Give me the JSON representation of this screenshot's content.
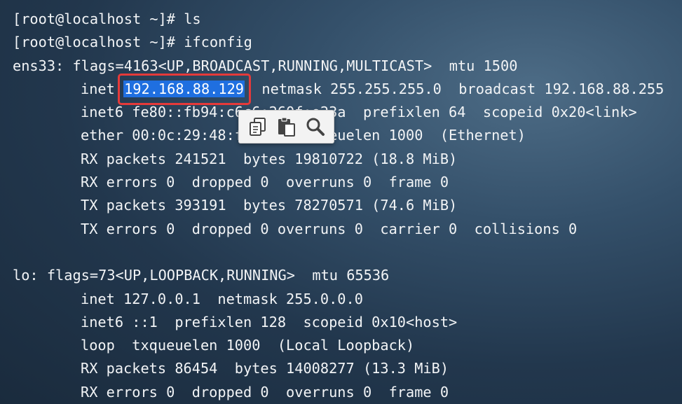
{
  "terminal": {
    "prompt_ls": "[root@localhost ~]# ls",
    "prompt_ifconfig": "[root@localhost ~]# ifconfig",
    "ens33": {
      "header": "ens33: flags=4163<UP,BROADCAST,RUNNING,MULTICAST>  mtu 1500",
      "inet_label": "inet ",
      "inet_ip": "192.168.88.129",
      "inet_rest": "  netmask 255.255.255.0  broadcast 192.168.88.255",
      "inet6": "inet6 fe80::fb94:c6c6:260f:e23a  prefixlen 64  scopeid 0x20<link>",
      "ether": "ether 00:0c:29:48:f4:bd  txqueuelen 1000  (Ethernet)",
      "rx_packets": "RX packets 241521  bytes 19810722 (18.8 MiB)",
      "rx_errors": "RX errors 0  dropped 0  overruns 0  frame 0",
      "tx_packets": "TX packets 393191  bytes 78270571 (74.6 MiB)",
      "tx_errors": "TX errors 0  dropped 0 overruns 0  carrier 0  collisions 0"
    },
    "lo": {
      "header": "lo: flags=73<UP,LOOPBACK,RUNNING>  mtu 65536",
      "inet": "inet 127.0.0.1  netmask 255.0.0.0",
      "inet6": "inet6 ::1  prefixlen 128  scopeid 0x10<host>",
      "loop": "loop  txqueuelen 1000  (Local Loopback)",
      "rx_packets": "RX packets 86454  bytes 14008277 (13.3 MiB)",
      "rx_errors": "RX errors 0  dropped 0  overruns 0  frame 0"
    }
  },
  "toolbar": {
    "icons": [
      "copy-icon",
      "paste-icon",
      "search-icon"
    ]
  },
  "colors": {
    "selection": "#1f6fe0",
    "highlight_outline": "#e53a3a",
    "text": "#f2f4f6"
  }
}
